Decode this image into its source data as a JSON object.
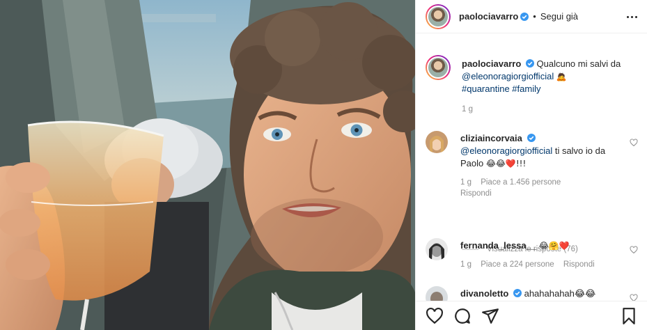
{
  "post": {
    "username": "paolociavarro",
    "follow_separator": "•",
    "follow_label": "Segui già"
  },
  "caption": {
    "username": "paolociavarro",
    "text_start": "Qualcuno mi salvi da",
    "mention": "@eleonoragiorgiofficial",
    "emoji": "🙇",
    "hashtag_1": "#quarantine",
    "hashtag_2": "#family",
    "time": "1 g"
  },
  "comments": [
    {
      "username": "cliziaincorvaia",
      "mention": "@eleonoragiorgiofficial",
      "text": "ti salvo io da Paolo",
      "emoji": "😂😂❤️!!!",
      "time": "1 g",
      "likes": "Piace a 1.456 persone",
      "reply": "Rispondi"
    },
    {
      "username": "fernanda_lessa__",
      "emoji": "😂🤗❤️",
      "time": "1 g",
      "likes": "Piace a 224 persone",
      "reply": "Rispondi"
    },
    {
      "username": "divanoletto",
      "text": "ahahahahah😂😂"
    }
  ],
  "view_replies": "Visualizza le risposte (76)",
  "icons": {
    "verified": "verified-badge-icon",
    "more": "more-options-icon",
    "like": "heart-icon",
    "comment": "comment-icon",
    "share": "share-icon",
    "save": "bookmark-icon"
  },
  "colors": {
    "verified": "#3897f0",
    "link": "#00376b",
    "muted": "#8e8e8e",
    "text": "#262626"
  }
}
